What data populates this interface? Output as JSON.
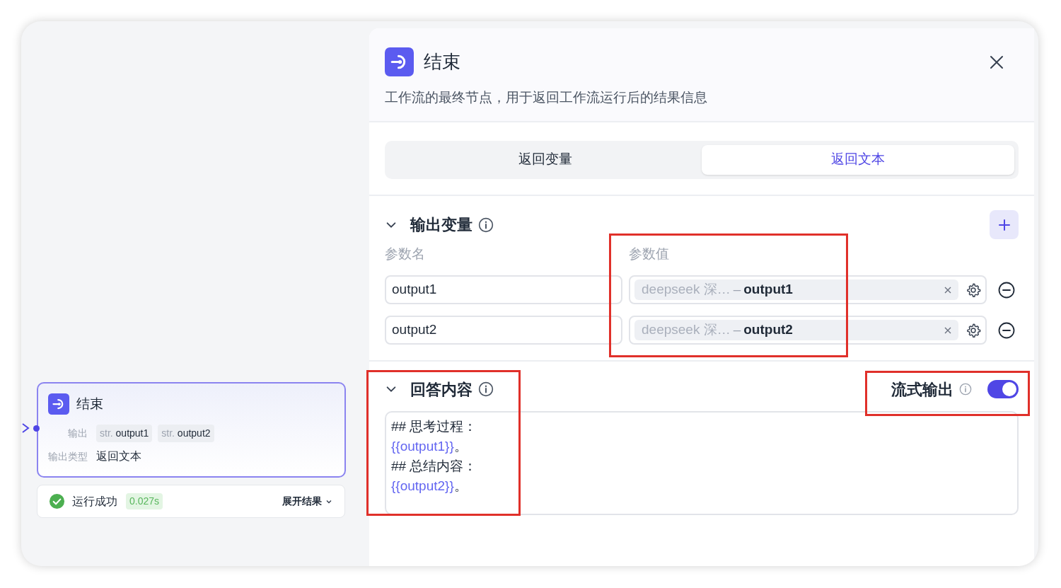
{
  "node_card": {
    "title": "结束",
    "output_label": "输出",
    "outputs": [
      {
        "type": "str.",
        "name": "output1"
      },
      {
        "type": "str.",
        "name": "output2"
      }
    ],
    "output_type_label": "输出类型",
    "output_type": "返回文本"
  },
  "run_result": {
    "status": "运行成功",
    "duration": "0.027s",
    "expand": "展开结果"
  },
  "panel": {
    "title": "结束",
    "description": "工作流的最终节点，用于返回工作流运行后的结果信息",
    "tabs": [
      {
        "label": "返回变量",
        "selected": false
      },
      {
        "label": "返回文本",
        "selected": true
      }
    ],
    "output_variables": {
      "title": "输出变量",
      "expanded": true,
      "name_header": "参数名",
      "value_header": "参数值",
      "rows": [
        {
          "name": "output1",
          "source": "deepseek 深…",
          "separator": "–",
          "variable": "output1"
        },
        {
          "name": "output2",
          "source": "deepseek 深…",
          "separator": "–",
          "variable": "output2"
        }
      ]
    },
    "answer": {
      "title": "回答内容",
      "expanded": true,
      "streaming_label": "流式输出",
      "streaming": true,
      "lines": [
        [
          {
            "kind": "plain",
            "text": "## 思考过程："
          }
        ],
        [
          {
            "kind": "variable",
            "text": "{{output1}}"
          },
          {
            "kind": "plain",
            "text": "。"
          }
        ],
        [
          {
            "kind": "plain",
            "text": "## 总结内容："
          }
        ],
        [
          {
            "kind": "variable",
            "text": "{{output2}}"
          },
          {
            "kind": "plain",
            "text": "。"
          }
        ]
      ]
    }
  }
}
